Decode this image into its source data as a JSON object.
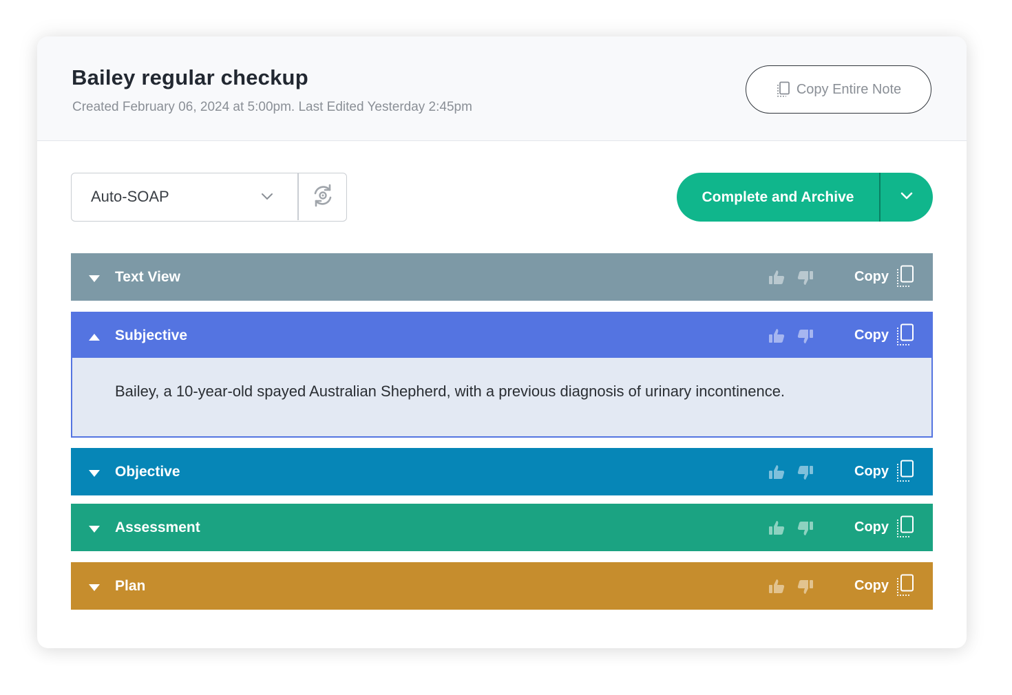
{
  "note": {
    "title": "Bailey regular checkup",
    "meta": "Created February 06, 2024 at 5:00pm. Last Edited Yesterday 2:45pm",
    "copy_entire_label": "Copy Entire Note"
  },
  "toolbar": {
    "template_selected": "Auto-SOAP",
    "regenerate_icon": "regenerate-icon",
    "complete_label": "Complete and Archive"
  },
  "sections": [
    {
      "title": "Text View",
      "expanded": false,
      "color": "#7d99a6",
      "copy_label": "Copy"
    },
    {
      "title": "Subjective",
      "expanded": true,
      "color": "#5474e1",
      "copy_label": "Copy",
      "body": "Bailey, a 10-year-old spayed Australian Shepherd, with a previous diagnosis of urinary incontinence."
    },
    {
      "title": "Objective",
      "expanded": false,
      "color": "#0686b7",
      "copy_label": "Copy"
    },
    {
      "title": "Assessment",
      "expanded": false,
      "color": "#1ba382",
      "copy_label": "Copy"
    },
    {
      "title": "Plan",
      "expanded": false,
      "color": "#c68d2d",
      "copy_label": "Copy"
    }
  ],
  "colors": {
    "accent_green": "#10b68c",
    "header_bg": "#f8f9fb",
    "subjective_body_bg": "#e3e9f3"
  }
}
